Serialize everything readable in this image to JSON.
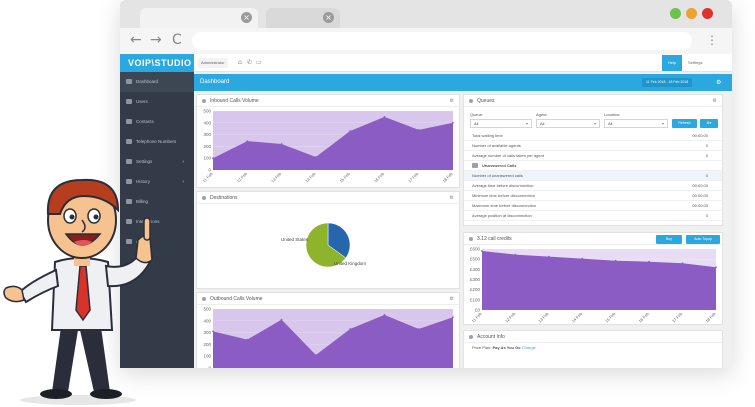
{
  "browser": {
    "controls": {
      "green": "#6cc24a",
      "orange": "#f2a02d",
      "red": "#e0322d"
    },
    "tab_close_glyph": "×",
    "nav": {
      "back": "←",
      "forward": "→",
      "reload": "C",
      "menu": "⋮"
    }
  },
  "app": {
    "logo": "VOIP\\STUDIO",
    "accent": "#2aa8df",
    "sidebar_bg": "#323b47",
    "topbar": {
      "account": "Administrator",
      "help": "Help",
      "settings": "Settings"
    },
    "title": "Dashboard",
    "date_range": "11 Feb 2018 - 18 Feb 2018",
    "sidebar": [
      {
        "label": "Dashboard",
        "icon": "monitor-icon",
        "active": true
      },
      {
        "label": "Users",
        "icon": "users-icon"
      },
      {
        "label": "Contacts",
        "icon": "contacts-icon"
      },
      {
        "label": "Telephone Numbers",
        "icon": "globe-icon"
      },
      {
        "label": "Settings",
        "icon": "gear-icon",
        "arrow": "›"
      },
      {
        "label": "History",
        "icon": "history-icon",
        "arrow": "›"
      },
      {
        "label": "Billing",
        "icon": "billing-icon"
      },
      {
        "label": "Integrations",
        "icon": "integrations-icon"
      },
      {
        "label": "API",
        "icon": "api-icon"
      }
    ]
  },
  "inbound": {
    "title": "Inbound Calls Volume",
    "gear": "⚙"
  },
  "destinations": {
    "title": "Destinations",
    "gear": "⚙",
    "label_a": "United States",
    "label_b": "United Kingdom"
  },
  "outbound": {
    "title": "Outbound Calls Volume",
    "gear": "⚙"
  },
  "queues": {
    "title": "Queues",
    "gear": "⚙",
    "queue_label": "Queue:",
    "agent_label": "Agent:",
    "location_label": "Location:",
    "queue_value": "All",
    "agent_value": "All",
    "location_value": "All",
    "refresh_label": "Refresh",
    "rows": [
      {
        "label": "Total waiting time",
        "value": "00:00:00"
      },
      {
        "label": "Number of available agents",
        "value": "0"
      },
      {
        "label": "Average number of calls taken per agent",
        "value": "0"
      },
      {
        "label": "Unanswered Calls",
        "value": "",
        "section": true
      },
      {
        "label": "Number of unanswered calls",
        "value": "0",
        "shaded": true
      },
      {
        "label": "Average time before disconnection",
        "value": "00:00:00"
      },
      {
        "label": "Minimum time before disconnection",
        "value": "00:00:00"
      },
      {
        "label": "Maximum time before disconnection",
        "value": "00:00:00"
      },
      {
        "label": "Average position at disconnection",
        "value": "0"
      }
    ]
  },
  "credits": {
    "title": "3.12 call credits",
    "buy": "Buy",
    "transfer": "Auto Topup"
  },
  "account": {
    "title": "Account Info",
    "plan_label": "Price Plan:",
    "plan_value": "Pay As You Go",
    "change": "Change"
  },
  "chart_data": [
    {
      "type": "area",
      "name": "inbound",
      "x": [
        "11 Feb",
        "12 Feb",
        "13 Feb",
        "14 Feb",
        "15 Feb",
        "16 Feb",
        "17 Feb",
        "18 Feb"
      ],
      "y": [
        100,
        245,
        220,
        110,
        330,
        450,
        340,
        400
      ],
      "ylim": [
        0,
        500
      ],
      "yticks": [
        0,
        100,
        200,
        300,
        400,
        500
      ]
    },
    {
      "type": "pie",
      "name": "destinations",
      "labels": [
        "United States",
        "United Kingdom"
      ],
      "values": [
        35,
        65
      ],
      "colors": [
        "#2566ad",
        "#8db42c"
      ]
    },
    {
      "type": "area",
      "name": "outbound",
      "x": [
        "11 Feb",
        "12 Feb",
        "13 Feb",
        "14 Feb",
        "15 Feb",
        "16 Feb",
        "17 Feb",
        "18 Feb"
      ],
      "y": [
        310,
        240,
        410,
        110,
        330,
        450,
        330,
        430
      ],
      "ylim": [
        0,
        500
      ],
      "yticks": [
        0,
        100,
        200,
        300,
        400,
        500
      ]
    },
    {
      "type": "area",
      "name": "credits",
      "x": [
        "11 Feb",
        "12 Feb",
        "13 Feb",
        "14 Feb",
        "15 Feb",
        "16 Feb",
        "17 Feb",
        "18 Feb"
      ],
      "y": [
        580,
        545,
        525,
        505,
        485,
        475,
        460,
        420
      ],
      "ylim": [
        0,
        600
      ],
      "ytick_labels": [
        "£0",
        "£100",
        "£200",
        "£300",
        "£400",
        "£500",
        "£600"
      ]
    }
  ]
}
